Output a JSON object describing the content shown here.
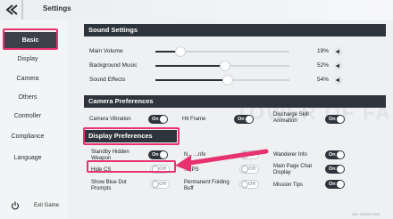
{
  "header": {
    "title": "Settings"
  },
  "sidebar": {
    "items": [
      {
        "label": "Basic",
        "active": true
      },
      {
        "label": "Display",
        "active": false
      },
      {
        "label": "Camera",
        "active": false
      },
      {
        "label": "Others",
        "active": false
      },
      {
        "label": "Controller",
        "active": false
      },
      {
        "label": "Compliance",
        "active": false
      },
      {
        "label": "Language",
        "active": false
      }
    ],
    "exit_label": "Exit Game"
  },
  "sound": {
    "title": "Sound Settings",
    "sliders": [
      {
        "label": "Main Volume",
        "value": "19%",
        "level": 0.19
      },
      {
        "label": "Background Music",
        "value": "52%",
        "level": 0.52
      },
      {
        "label": "Sound Effects",
        "value": "54%",
        "level": 0.54
      }
    ]
  },
  "camera": {
    "title": "Camera Preferences",
    "options": [
      {
        "label": "Camera Vibration",
        "state": "On"
      },
      {
        "label": "Hit Frame",
        "state": "On"
      },
      {
        "label": "Discharge Skill Animation",
        "state": "On"
      }
    ]
  },
  "display": {
    "title": "Display Preferences",
    "options": [
      {
        "label": "Standby Hidden Weapon",
        "state": "On"
      },
      {
        "label": "N... ...nfo",
        "state": "Off"
      },
      {
        "label": "Wanderer Info",
        "state": "On"
      },
      {
        "label": "Hide CS",
        "state": "Off"
      },
      {
        "label": "...FPS",
        "state": "Off"
      },
      {
        "label": "Main Page Chat Display",
        "state": "On"
      },
      {
        "label": "Show Blue Dot Prompts",
        "state": "Off"
      },
      {
        "label": "Permanent Folding Buff",
        "state": "Off"
      },
      {
        "label": "Mission Tips",
        "state": "On"
      }
    ]
  },
  "watermark": "TOWER OF FANTASY",
  "uid": "UID: 5002927992",
  "colors": {
    "highlight": "#e8326f",
    "dark": "#2e343b"
  }
}
